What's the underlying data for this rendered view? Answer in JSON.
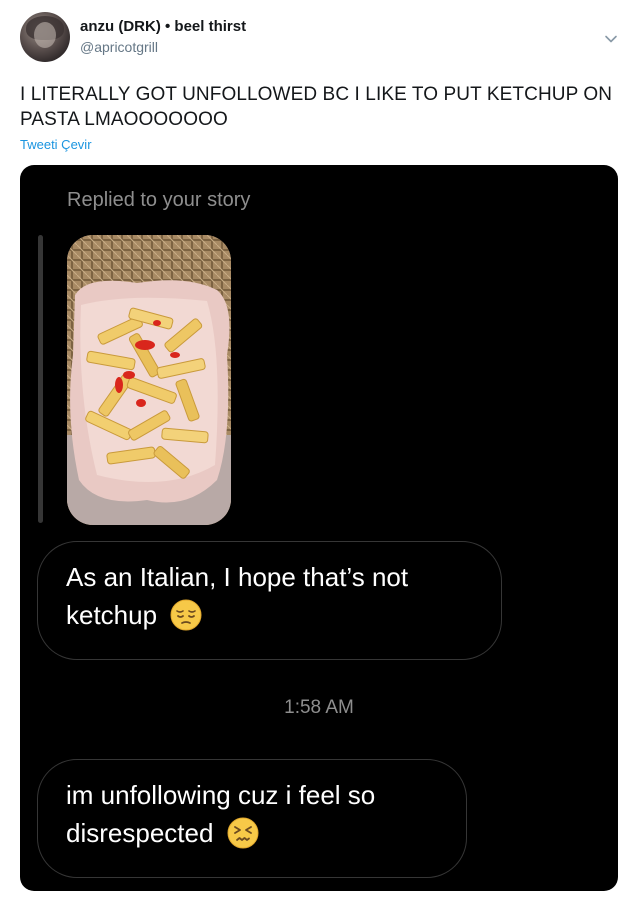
{
  "tweet": {
    "author_name": "anzu (DRK) • beel thirst",
    "handle": "@apricotgrill",
    "text": "I LITERALLY GOT UNFOLLOWED BC I LIKE TO PUT KETCHUP ON PASTA LMAOOOOOOO",
    "translate_label": "Tweeti Çevir"
  },
  "screenshot": {
    "replied_label": "Replied to your story",
    "message_1": "As an Italian, I hope that’s not ketchup",
    "timestamp": "1:58 AM",
    "message_2": "im unfollowing cuz i feel so disrespected"
  },
  "icons": {
    "menu": "chevron-down-icon",
    "emoji_1": "pensive-face-emoji",
    "emoji_2": "confounded-face-emoji"
  },
  "colors": {
    "link": "#1b95e0",
    "handle": "#657786",
    "media_bg": "#000000",
    "bubble_border": "#363636",
    "muted_text": "#8e8e8e"
  }
}
